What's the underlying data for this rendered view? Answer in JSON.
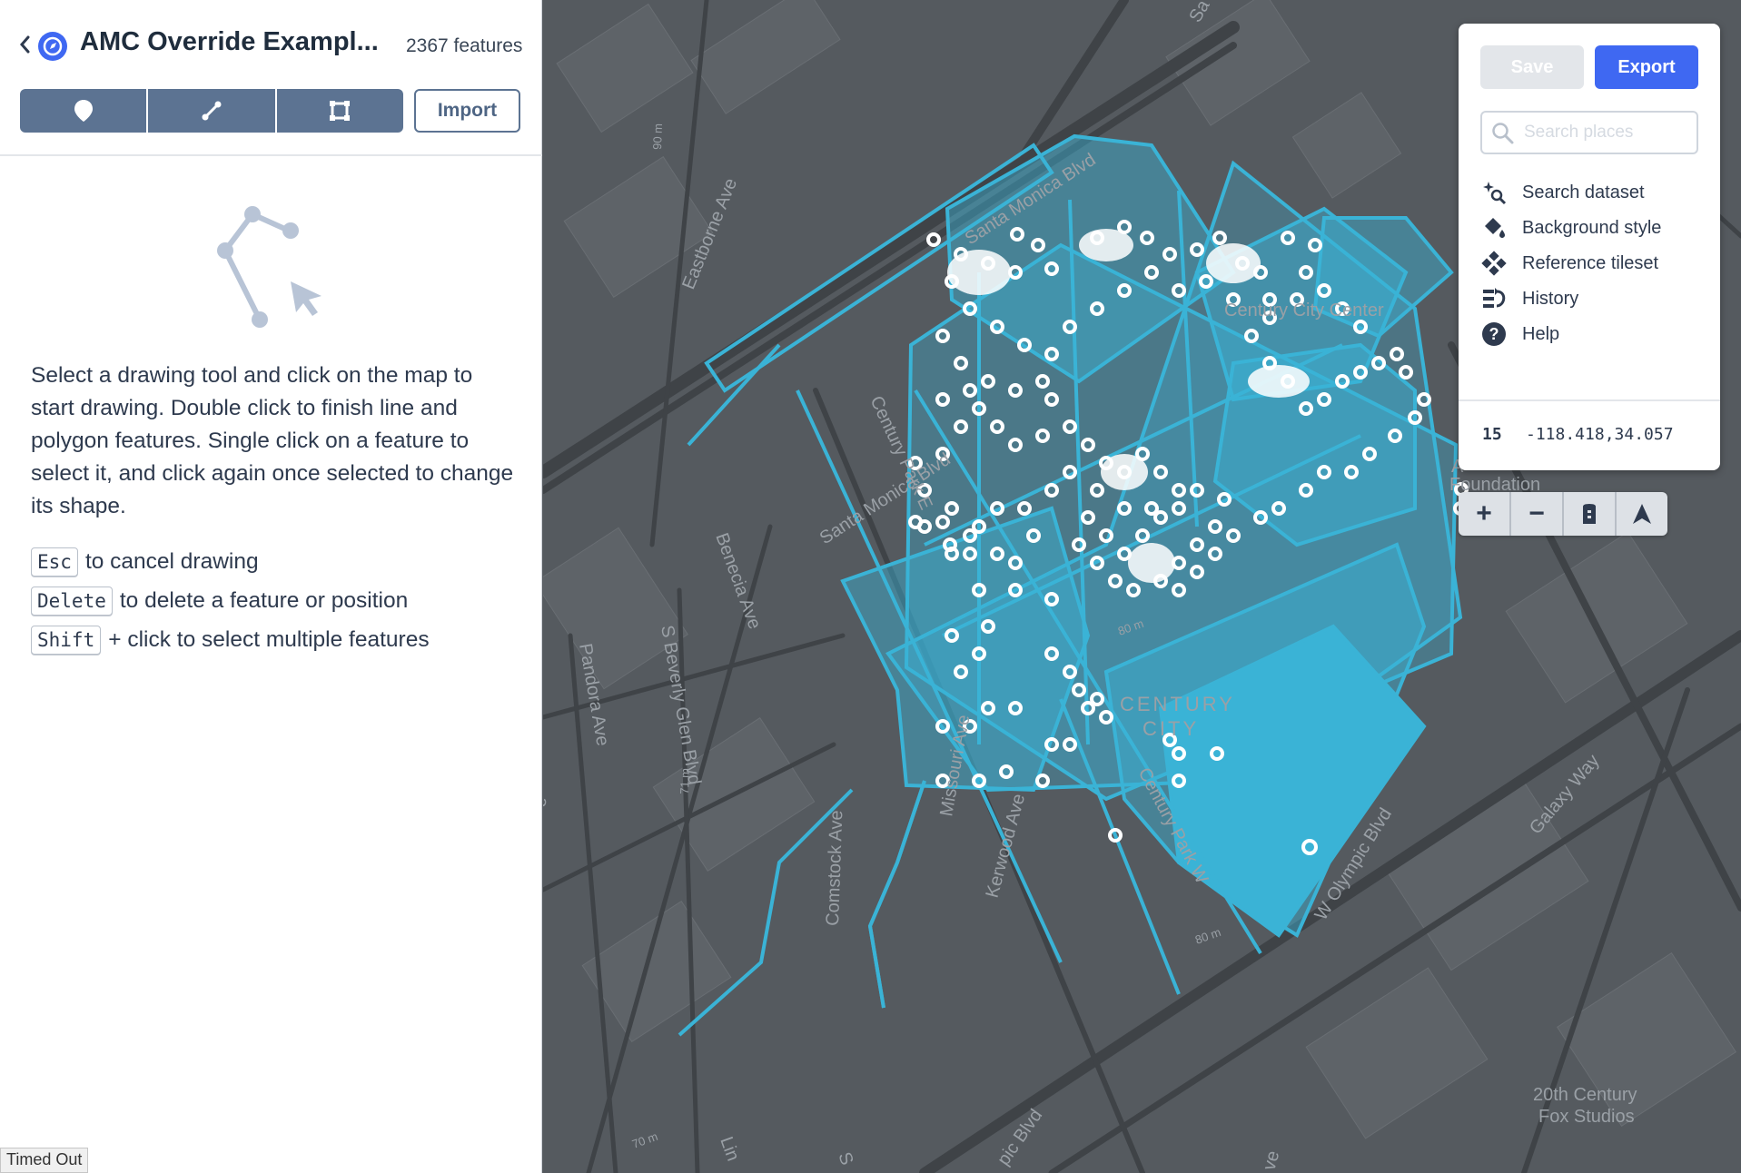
{
  "header": {
    "back_icon": "chevron-left-icon",
    "dataset_icon": "dataset-icon",
    "title": "AMC Override Exampl...",
    "feature_count": "2367 features",
    "tools": [
      {
        "icon": "point-marker-icon",
        "name": "point"
      },
      {
        "icon": "line-icon",
        "name": "line"
      },
      {
        "icon": "polygon-icon",
        "name": "polygon"
      }
    ],
    "import_label": "Import"
  },
  "instructions": {
    "text": "Select a drawing tool and click on the map to start drawing. Double click to finish line and polygon features. Single click on a feature to select it, and click again once selected to change its shape.",
    "shortcuts": [
      {
        "key": "Esc",
        "desc": "to cancel drawing"
      },
      {
        "key": "Delete",
        "desc": "to delete a feature or position"
      },
      {
        "key": "Shift",
        "desc": "+ click to select multiple features"
      }
    ]
  },
  "status": {
    "timeout": "Timed Out"
  },
  "panel": {
    "save_label": "Save",
    "export_label": "Export",
    "search_placeholder": "Search places",
    "menu": [
      {
        "icon": "sparkle-search-icon",
        "label": "Search dataset"
      },
      {
        "icon": "paint-bucket-icon",
        "label": "Background style"
      },
      {
        "icon": "tileset-icon",
        "label": "Reference tileset"
      },
      {
        "icon": "history-icon",
        "label": "History"
      },
      {
        "icon": "help-icon",
        "label": "Help"
      }
    ],
    "zoom": "15",
    "coords": "-118.418,34.057"
  },
  "map_controls": {
    "zoom_in": "+",
    "zoom_out": "−",
    "icons": [
      "plus-icon",
      "minus-icon",
      "lock-icon",
      "compass-north-icon"
    ]
  },
  "map_labels": {
    "santa_monica": "Santa Monica Blvd",
    "santa_monica_2": "Santa Monica Blvd",
    "eastborne": "Eastborne Ave",
    "century_park_e": "Century Park E",
    "benecia": "Benecia Ave",
    "pandora": "Pandora Ave",
    "beverly_glen": "S Beverly Glen Blvd",
    "comstock": "Comstock Ave",
    "kerwood": "Kerwood Ave",
    "missouri": "Missouri Ave",
    "century_park_w": "Century Park W",
    "olympic": "W Olympic Blvd",
    "galaxy": "Galaxy Way",
    "century_city_center": "Century City Center",
    "century_city_1": "CENTURY",
    "century_city_2": "CITY",
    "foundation_1": "A",
    "foundation_2": "Foundation",
    "fox_1": "20th Century",
    "fox_2": "Fox Studios",
    "elev_80m": "80 m",
    "elev_80m_2": "80 m",
    "elev_71m": "71 m",
    "elev_70m": "70 m",
    "elev_90m": "90 m",
    "road_top": "Sa",
    "road_bottom_1": "S",
    "road_bottom_2": "Lin",
    "road_bottom_3": "pic Blvd",
    "road_edge": "e",
    "road_edge_2": "ve",
    "accent_color": "#3ab3d6",
    "map_bg": "#555a5f"
  }
}
